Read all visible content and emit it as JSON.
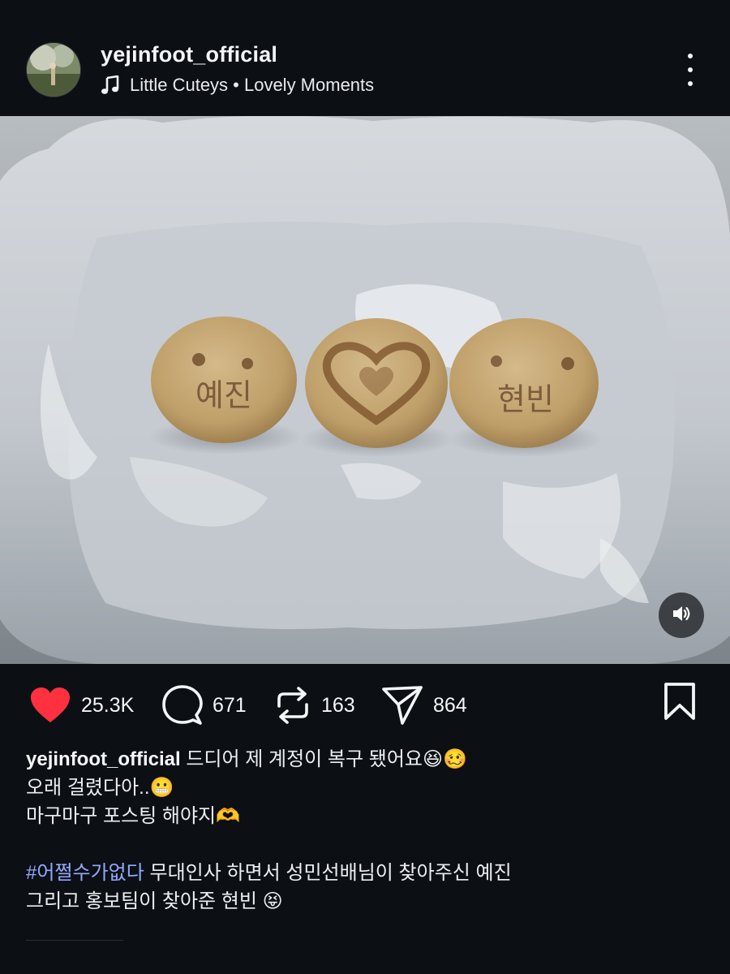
{
  "header": {
    "username": "yejinfoot_official",
    "music": "Little Cuteys • Lovely Moments",
    "avatar_icon": "profile-avatar",
    "more_icon": "vertical-dots-icon"
  },
  "media": {
    "cookies": [
      {
        "text": "예진",
        "kind": "text-cookie"
      },
      {
        "kind": "heart-cookie"
      },
      {
        "text": "현빈",
        "kind": "text-cookie"
      }
    ],
    "mute_icon": "speaker-icon"
  },
  "actions": {
    "likes": "25.3K",
    "comments": "671",
    "reposts": "163",
    "shares": "864",
    "like_color": "#ff3040",
    "icons": [
      "heart-icon",
      "comment-icon",
      "repost-icon",
      "share-icon",
      "bookmark-icon"
    ]
  },
  "caption": {
    "username": "yejinfoot_official",
    "line1_text": " 드디어 제 계정이 복구 됐어요😆🥴",
    "line2": "오래 걸렸다아..😬",
    "line3": "마구마구 포스팅 해야지🫶",
    "hashtag": "#어쩔수가없다",
    "line4_text": " 무대인사 하면서 성민선배님이 찾아주신 예진",
    "line5": "그리고 홍보팀이 찾아준 현빈 😝",
    "hashtag_color": "#93a9ff"
  }
}
